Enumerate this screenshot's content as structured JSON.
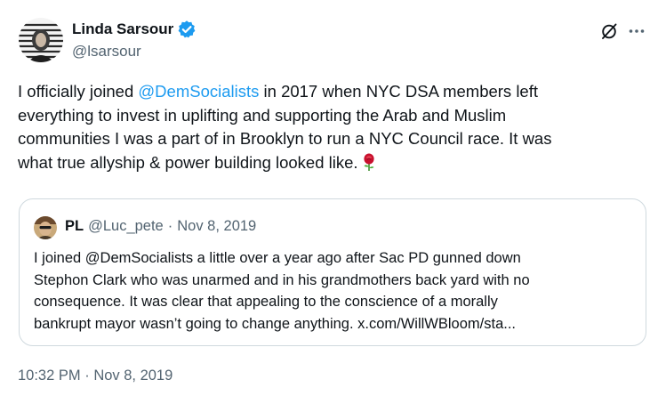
{
  "author": {
    "name": "Linda Sarsour",
    "handle": "@lsarsour",
    "verified_color": "#1d9bf0"
  },
  "tweet": {
    "lines": [
      [
        "I officially joined ",
        "@DemSocialists",
        " in 2017 when NYC DSA members left"
      ],
      "everything to invest in uplifting and supporting the Arab and Muslim",
      "communities I was a part of in Brooklyn to run a NYC Council race. It was",
      "what true allyship & power building looked like."
    ],
    "line1_pre": "I officially joined ",
    "line1_mention": "@DemSocialists",
    "line1_post": " in 2017 when NYC DSA members left",
    "line2": "everything to invest in uplifting and supporting the Arab and Muslim",
    "line3": "communities I was a part of in Brooklyn to run a NYC Council race. It was",
    "line4": "what true allyship & power building looked like.",
    "emoji": "rose-icon",
    "mention_color": "#1d9bf0"
  },
  "quote": {
    "name": "PL",
    "handle": "@Luc_pete",
    "separator": "·",
    "date": "Nov 8, 2019",
    "line1": "I joined @DemSocialists a little over a year ago after Sac PD gunned down",
    "line2": "Stephon Clark who was unarmed and in his grandmothers back yard with no",
    "line3": "consequence. It was clear that appealing to the conscience of a morally",
    "line4": "bankrupt mayor wasn’t going to change anything. x.com/WillWBloom/sta..."
  },
  "timestamp": {
    "time": "10:32 PM",
    "separator": "·",
    "date": "Nov 8, 2019"
  },
  "icons": {
    "grok": "grok-icon",
    "more": "more-icon"
  }
}
